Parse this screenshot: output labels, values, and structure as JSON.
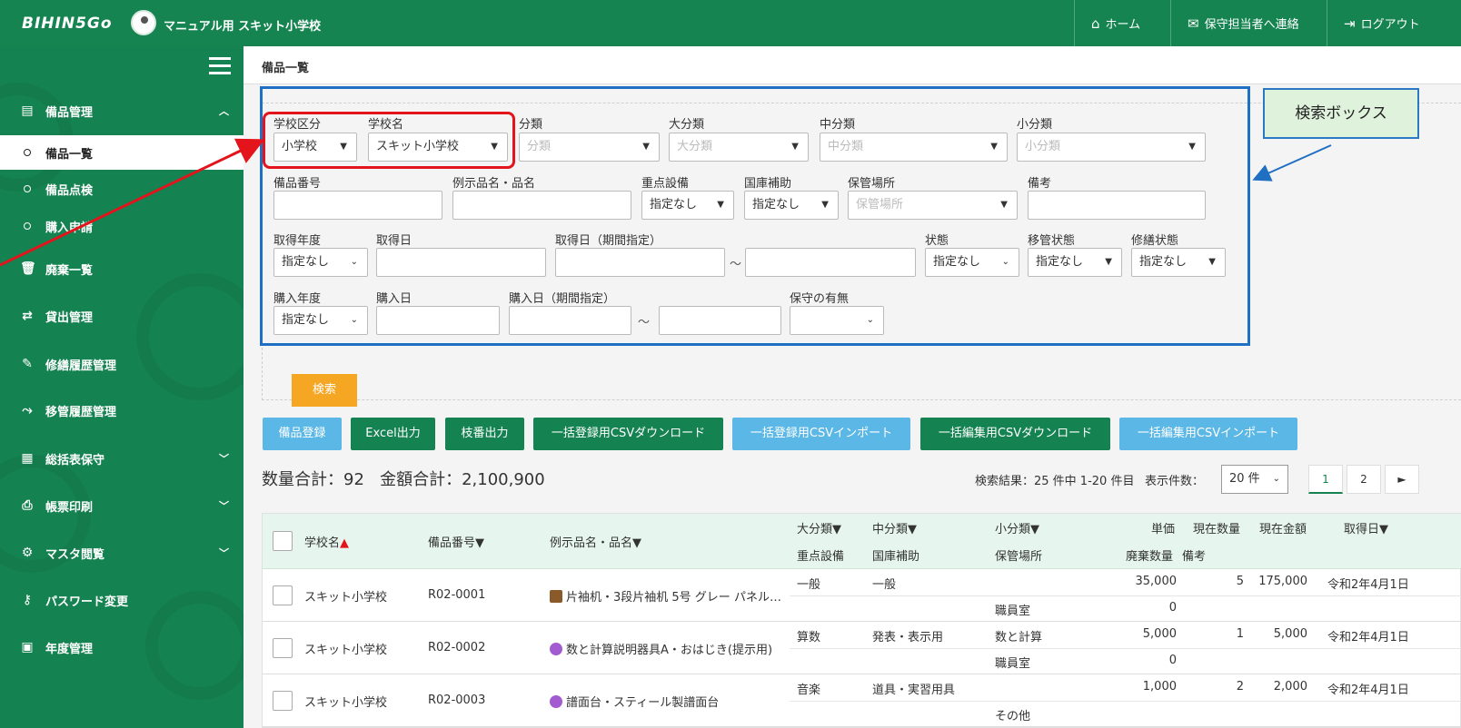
{
  "topbar": {
    "logo": "BIHIN5Go",
    "school": "マニュアル用 スキット小学校",
    "nav": [
      "ホーム",
      "保守担当者へ連絡",
      "ログアウト"
    ]
  },
  "sidebar": {
    "sections": [
      {
        "label": "備品管理",
        "icon": "inventory-icon",
        "expanded": true
      },
      {
        "label": "廃棄一覧",
        "icon": "trash-icon"
      },
      {
        "label": "貸出管理",
        "icon": "transfer-icon"
      },
      {
        "label": "修繕履歴管理",
        "icon": "wrench-icon"
      },
      {
        "label": "移管履歴管理",
        "icon": "move-icon"
      },
      {
        "label": "総括表保守",
        "icon": "list-icon"
      },
      {
        "label": "帳票印刷",
        "icon": "print-icon"
      },
      {
        "label": "マスタ閲覧",
        "icon": "gear-icon"
      },
      {
        "label": "パスワード変更",
        "icon": "key-icon"
      },
      {
        "label": "年度管理",
        "icon": "calendar-icon"
      }
    ],
    "sub_items": [
      "備品一覧",
      "備品点検",
      "購入申請"
    ]
  },
  "breadcrumb": "備品一覧",
  "search": {
    "labels": {
      "school_type": "学校区分",
      "school_name": "学校名",
      "category": "分類",
      "major": "大分類",
      "middle": "中分類",
      "minor": "小分類",
      "item_no": "備品番号",
      "item_name": "例示品名・品名",
      "priority": "重点設備",
      "subsidy": "国庫補助",
      "storage": "保管場所",
      "notes": "備考",
      "acq_year": "取得年度",
      "acq_date": "取得日",
      "acq_period": "取得日（期間指定）",
      "state": "状態",
      "transfer_state": "移管状態",
      "repair_state": "修繕状態",
      "buy_year": "購入年度",
      "buy_date": "購入日",
      "buy_period": "購入日（期間指定）",
      "maintenance": "保守の有無"
    },
    "values": {
      "school_type": "小学校",
      "school_name": "スキット小学校",
      "priority": "指定なし",
      "subsidy": "指定なし",
      "acq_year": "指定なし",
      "state": "指定なし",
      "transfer_state": "指定なし",
      "repair_state": "指定なし",
      "buy_year": "指定なし"
    },
    "placeholders": {
      "category": "分類",
      "major": "大分類",
      "middle": "中分類",
      "minor": "小分類",
      "storage": "保管場所"
    },
    "tilde": "～",
    "button": "検索"
  },
  "actions": [
    "備品登録",
    "Excel出力",
    "枝番出力",
    "一括登録用CSVダウンロード",
    "一括登録用CSVインポート",
    "一括編集用CSVダウンロード",
    "一括編集用CSVインポート"
  ],
  "summary": {
    "total_qty": "数量合計：92",
    "total_amount": "金額合計：2,100,900",
    "result": "検索結果：25 件中 1-20 件目",
    "perpage_label": "表示件数：",
    "perpage": "20 件",
    "pages": [
      "1",
      "2",
      "►"
    ]
  },
  "table": {
    "headers": {
      "school": "学校名",
      "item_no": "備品番号▼",
      "name": "例示品名・品名▼",
      "major": "大分類▼",
      "middle": "中分類▼",
      "minor": "小分類▼",
      "price": "単価",
      "qty": "現在数量",
      "amount": "現在金額",
      "acq": "取得日▼",
      "priority": "重点設備",
      "subsidy": "国庫補助",
      "storage": "保管場所",
      "disposal": "廃棄数量",
      "notes": "備考",
      "sort_up": "▲"
    },
    "rows": [
      {
        "school": "スキット小学校",
        "item_no": "R02-0001",
        "name": "片袖机・3段片袖机 5号 グレー パネル…",
        "major": "一般",
        "middle": "一般",
        "minor": "",
        "storage": "職員室",
        "price": "35,000",
        "qty": "5",
        "amount": "175,000",
        "acq": "令和2年4月1日",
        "disposal": "0"
      },
      {
        "school": "スキット小学校",
        "item_no": "R02-0002",
        "name": "数と計算説明器具A・おはじき(提示用)",
        "major": "算数",
        "middle": "発表・表示用",
        "minor": "数と計算",
        "storage": "職員室",
        "price": "5,000",
        "qty": "1",
        "amount": "5,000",
        "acq": "令和2年4月1日",
        "disposal": "0"
      },
      {
        "school": "スキット小学校",
        "item_no": "R02-0003",
        "name": "譜面台・スティール製譜面台",
        "major": "音楽",
        "middle": "道具・実習用具",
        "minor": "",
        "storage": "その他",
        "price": "1,000",
        "qty": "2",
        "amount": "2,000",
        "acq": "令和2年4月1日",
        "disposal": ""
      }
    ]
  },
  "annotation": {
    "callout": "検索ボックス",
    "colors": {
      "callout_border": "#2b78c4",
      "highlight": "#e3141b"
    }
  },
  "colors": {
    "brand": "#158351",
    "search_button": "#f5a623",
    "blue_button": "#5bb7e5"
  }
}
